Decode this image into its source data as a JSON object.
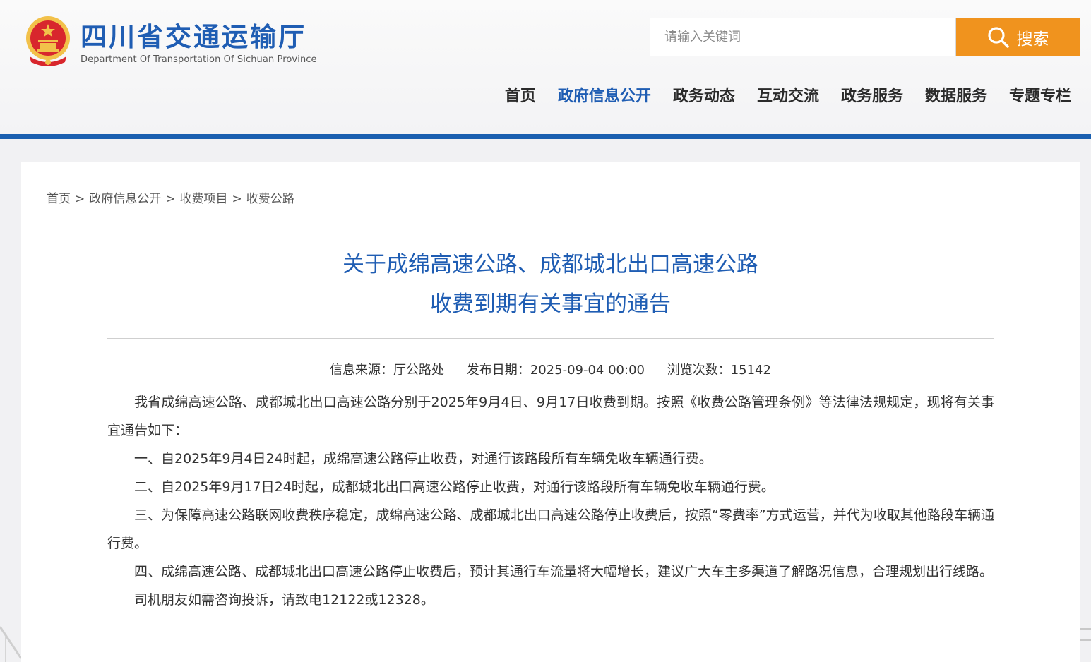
{
  "header": {
    "site_title": "四川省交通运输厅",
    "site_subtitle": "Department Of Transportation Of Sichuan Province",
    "search": {
      "placeholder": "请输入关键词",
      "button_label": "搜索"
    },
    "nav": [
      {
        "label": "首页",
        "active": false
      },
      {
        "label": "政府信息公开",
        "active": true
      },
      {
        "label": "政务动态",
        "active": false
      },
      {
        "label": "互动交流",
        "active": false
      },
      {
        "label": "政务服务",
        "active": false
      },
      {
        "label": "数据服务",
        "active": false
      },
      {
        "label": "专题专栏",
        "active": false
      }
    ]
  },
  "breadcrumb": {
    "items": [
      "首页",
      "政府信息公开",
      "收费项目",
      "收费公路"
    ],
    "separator": ">"
  },
  "article": {
    "title_line1": "关于成绵高速公路、成都城北出口高速公路",
    "title_line2": "收费到期有关事宜的通告",
    "meta": {
      "source": "信息来源：厅公路处",
      "date": "发布日期：2025-09-04 00:00",
      "views": "浏览次数：15142"
    },
    "paragraphs": [
      "我省成绵高速公路、成都城北出口高速公路分别于2025年9月4日、9月17日收费到期。按照《收费公路管理条例》等法律法规规定，现将有关事宜通告如下：",
      "一、自2025年9月4日24时起，成绵高速公路停止收费，对通行该路段所有车辆免收车辆通行费。",
      "二、自2025年9月17日24时起，成都城北出口高速公路停止收费，对通行该路段所有车辆免收车辆通行费。",
      "三、为保障高速公路联网收费秩序稳定，成绵高速公路、成都城北出口高速公路停止收费后，按照“零费率”方式运营，并代为收取其他路段车辆通行费。",
      "四、成绵高速公路、成都城北出口高速公路停止收费后，预计其通行车流量将大幅增长，建议广大车主多渠道了解路况信息，合理规划出行线路。",
      "司机朋友如需咨询投诉，请致电12122或12328。"
    ]
  },
  "colors": {
    "brand_blue": "#1f5db3",
    "header_rule": "#1a5fb0",
    "search_orange": "#f0931e",
    "emblem_red": "#d8262d",
    "emblem_gold": "#f2c14a"
  },
  "icons": {
    "emblem": "national-emblem-icon",
    "search": "search-icon"
  }
}
